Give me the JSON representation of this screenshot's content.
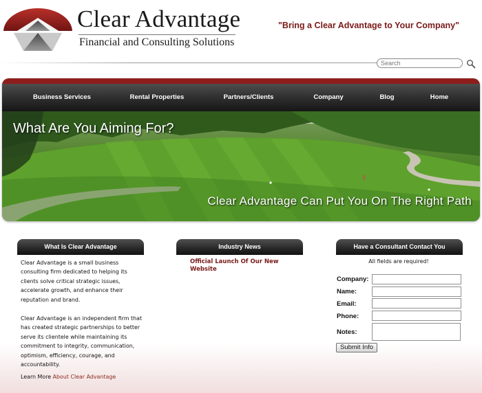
{
  "brand": {
    "name": "Clear Advantage",
    "subtitle": "Financial and Consulting Solutions",
    "tagline": "\"Bring a Clear Advantage to Your Company\""
  },
  "search": {
    "placeholder": "Search",
    "icon": "magnifier-icon"
  },
  "nav": {
    "items": [
      {
        "label": "Business Services"
      },
      {
        "label": "Rental Properties"
      },
      {
        "label": "Partners/Clients"
      },
      {
        "label": "Company"
      },
      {
        "label": "Blog"
      },
      {
        "label": "Home"
      }
    ]
  },
  "hero": {
    "title": "What Are You Aiming For?",
    "subtitle": "Clear Advantage Can Put You On The Right Path"
  },
  "about": {
    "heading": "What Is Clear Advantage",
    "paragraphs": [
      "Clear Advantage is a small business consulting firm dedicated to helping its clients solve critical strategic issues, accelerate growth, and enhance their reputation and brand.",
      "Clear Advantage is an independent firm that has created strategic partnerships to better serve its clientele while maintaining its commitment to integrity, communication, optimism, efficiency, courage, and accountability."
    ],
    "learn_more_prefix": "Learn More ",
    "learn_more_link": "About Clear Advantage"
  },
  "news": {
    "heading": "Industry News",
    "items": [
      {
        "title": "Official Launch Of Our New Website"
      }
    ]
  },
  "contact": {
    "heading": "Have a Consultant Contact You",
    "note": "All fields are required!",
    "fields": [
      {
        "label": "Company:",
        "value": ""
      },
      {
        "label": "Name:",
        "value": ""
      },
      {
        "label": "Email:",
        "value": ""
      },
      {
        "label": "Phone:",
        "value": ""
      },
      {
        "label": "Notes:",
        "value": ""
      }
    ],
    "submit_label": "Submit Info"
  },
  "colors": {
    "brand_red": "#7a1a18",
    "nav_dark": "#2a2a2a",
    "link_red": "#8a2b1f"
  }
}
